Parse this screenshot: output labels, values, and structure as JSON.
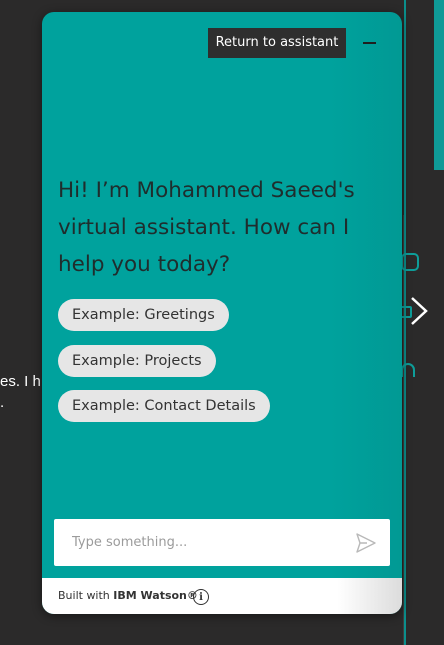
{
  "background": {
    "text_line_1": "es. I h",
    "text_line_2": "."
  },
  "widget": {
    "return_button_label": "Return to assistant",
    "minimize_label": "Minimize",
    "greeting": "Hi! I’m Mohammed Saeed's virtual assistant. How can I help you today?",
    "suggestions": [
      {
        "label": "Example: Greetings"
      },
      {
        "label": "Example: Projects"
      },
      {
        "label": "Example: Contact Details"
      }
    ],
    "input": {
      "placeholder": "Type something...",
      "value": ""
    },
    "send_icon": "send-icon",
    "footer": {
      "prefix": "Built with",
      "brand": "IBM Watson®",
      "info_glyph": "i"
    }
  },
  "colors": {
    "widget_teal": "#00a29d",
    "page_background": "#2b2a2a",
    "accent_rule": "#0b8f8c",
    "chip_background": "#e6e6e6",
    "button_dark": "#2e2e2e"
  }
}
